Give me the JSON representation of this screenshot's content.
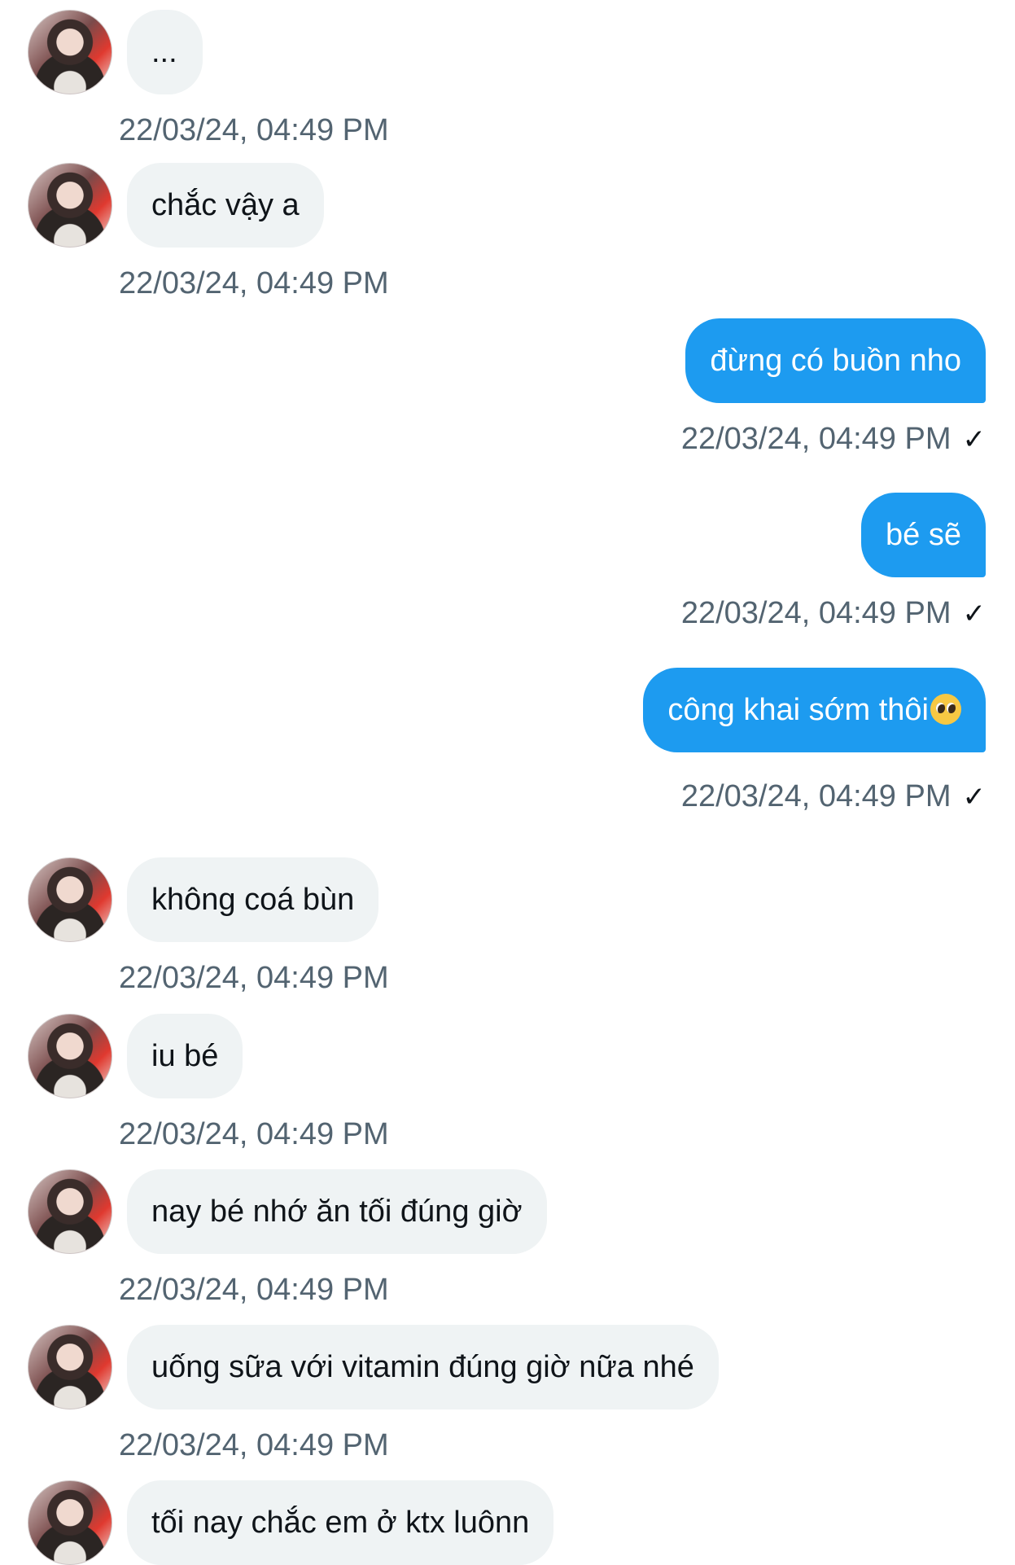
{
  "messages": [
    {
      "side": "in",
      "text": "...",
      "time": "22/03/24, 04:49 PM"
    },
    {
      "side": "in",
      "text": "chắc vậy a",
      "time": "22/03/24, 04:49 PM"
    },
    {
      "side": "out",
      "text": "đừng có buồn nho",
      "time": "22/03/24, 04:49 PM",
      "status": "✓"
    },
    {
      "side": "out",
      "text": "bé sẽ",
      "time": "22/03/24, 04:49 PM",
      "status": "✓"
    },
    {
      "side": "out",
      "text": "công khai sớm thôi",
      "emoji": "pleading-face-emoji",
      "time": "22/03/24, 04:49 PM",
      "status": "✓"
    },
    {
      "side": "in",
      "text": "không coá bùn",
      "time": "22/03/24, 04:49 PM"
    },
    {
      "side": "in",
      "text": "iu bé",
      "time": "22/03/24, 04:49 PM"
    },
    {
      "side": "in",
      "text": "nay bé nhớ ăn tối đúng giờ",
      "time": "22/03/24, 04:49 PM"
    },
    {
      "side": "in",
      "text": "uống sữa với vitamin đúng giờ nữa nhé",
      "time": "22/03/24, 04:49 PM"
    },
    {
      "side": "in",
      "text": "tối nay chắc em ở ktx luônn",
      "time": ""
    }
  ],
  "colors": {
    "outgoing_bubble": "#1d9bf0",
    "incoming_bubble": "#eff3f4",
    "timestamp": "#536471"
  }
}
